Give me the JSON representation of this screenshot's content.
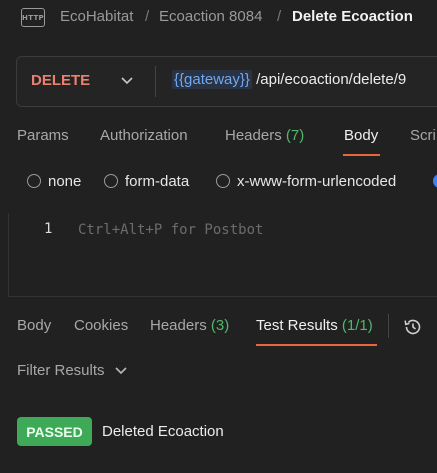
{
  "breadcrumb": {
    "icon_label": "HTTP",
    "items": [
      "EcoHabitat",
      "Ecoaction 8084",
      "Delete Ecoaction"
    ],
    "separator": "/"
  },
  "request": {
    "method": "DELETE",
    "method_color": "#e8816e",
    "url_variable": "{{gateway}}",
    "url_path": "/api/ecoaction/delete/9"
  },
  "request_tabs": {
    "params": "Params",
    "authorization": "Authorization",
    "headers": "Headers",
    "headers_count": "(7)",
    "body": "Body",
    "scripts": "Scri",
    "active": "Body"
  },
  "body_types": [
    "none",
    "form-data",
    "x-www-form-urlencoded"
  ],
  "editor": {
    "line_number": "1",
    "placeholder": "Ctrl+Alt+P for Postbot"
  },
  "response_tabs": {
    "body": "Body",
    "cookies": "Cookies",
    "headers": "Headers",
    "headers_count": "(3)",
    "test_results": "Test Results",
    "test_results_count": "(1/1)",
    "active": "Test Results"
  },
  "filter": {
    "label": "Filter Results"
  },
  "results": [
    {
      "status": "PASSED",
      "name": "Deleted Ecoaction",
      "status_color": "#3eaa58"
    }
  ],
  "colors": {
    "background": "#212121",
    "accent": "#e8663d",
    "count_green": "#4fb869",
    "variable_blue": "#6ea8f2"
  }
}
